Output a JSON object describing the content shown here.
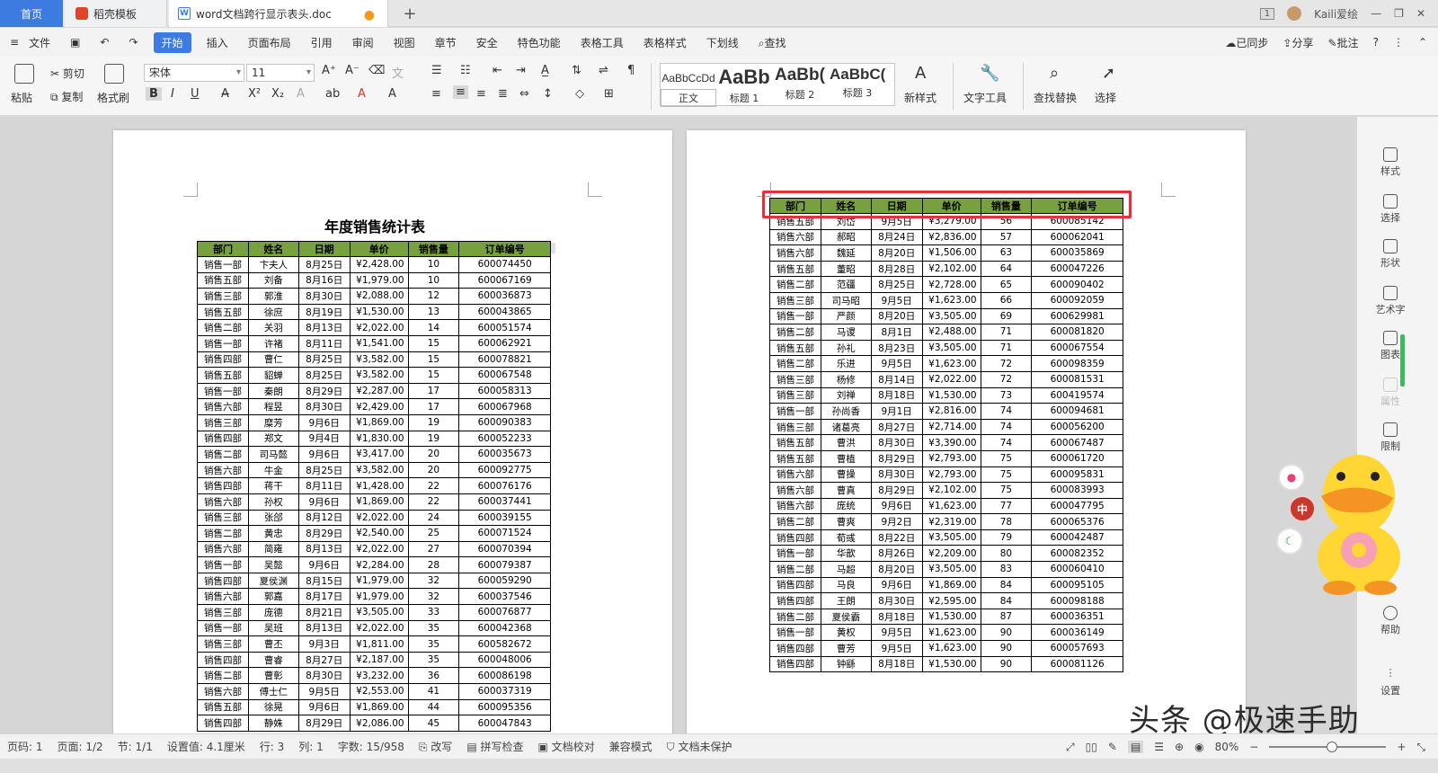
{
  "tabs": {
    "home": "首页",
    "template": "稻壳模板",
    "doc": "word文档跨行显示表头.doc",
    "doc_icon": "W"
  },
  "window": {
    "count": "1",
    "user": "Kaili爱绘"
  },
  "menu": {
    "file": "文件",
    "items": [
      "开始",
      "插入",
      "页面布局",
      "引用",
      "审阅",
      "视图",
      "章节",
      "安全",
      "特色功能",
      "表格工具",
      "表格样式",
      "下划线"
    ],
    "search": "查找",
    "sync": "已同步",
    "share": "分享",
    "comment": "批注"
  },
  "ribbon": {
    "paste": "粘贴",
    "cut": "剪切",
    "copy": "复制",
    "format_painter": "格式刷",
    "font_name": "宋体",
    "font_size": "11",
    "styles": [
      {
        "preview": "AaBbCcDd",
        "label": "正文"
      },
      {
        "preview": "AaBb",
        "label": "标题 1"
      },
      {
        "preview": "AaBb(",
        "label": "标题 2"
      },
      {
        "preview": "AaBbC(",
        "label": "标题 3"
      }
    ],
    "new_style": "新样式",
    "text_tools": "文字工具",
    "find_replace": "查找替换",
    "select": "选择"
  },
  "document": {
    "title": "年度销售统计表",
    "headers": [
      "部门",
      "姓名",
      "日期",
      "单价",
      "销售量",
      "订单编号"
    ],
    "page1_rows": [
      [
        "销售一部",
        "卞夫人",
        "8月25日",
        "¥2,428.00",
        "10",
        "600074450"
      ],
      [
        "销售五部",
        "刘备",
        "8月16日",
        "¥1,979.00",
        "10",
        "600067169"
      ],
      [
        "销售三部",
        "郭淮",
        "8月30日",
        "¥2,088.00",
        "12",
        "600036873"
      ],
      [
        "销售五部",
        "徐庶",
        "8月19日",
        "¥1,530.00",
        "13",
        "600043865"
      ],
      [
        "销售二部",
        "关羽",
        "8月13日",
        "¥2,022.00",
        "14",
        "600051574"
      ],
      [
        "销售一部",
        "许褚",
        "8月11日",
        "¥1,541.00",
        "15",
        "600062921"
      ],
      [
        "销售四部",
        "曹仁",
        "8月25日",
        "¥3,582.00",
        "15",
        "600078821"
      ],
      [
        "销售五部",
        "貂蝉",
        "8月25日",
        "¥3,582.00",
        "15",
        "600067548"
      ],
      [
        "销售一部",
        "秦朗",
        "8月29日",
        "¥2,287.00",
        "17",
        "600058313"
      ],
      [
        "销售六部",
        "程昱",
        "8月30日",
        "¥2,429.00",
        "17",
        "600067968"
      ],
      [
        "销售三部",
        "糜芳",
        "9月6日",
        "¥1,869.00",
        "19",
        "600090383"
      ],
      [
        "销售四部",
        "郑文",
        "9月4日",
        "¥1,830.00",
        "19",
        "600052233"
      ],
      [
        "销售二部",
        "司马懿",
        "9月6日",
        "¥3,417.00",
        "20",
        "600035673"
      ],
      [
        "销售六部",
        "牛金",
        "8月25日",
        "¥3,582.00",
        "20",
        "600092775"
      ],
      [
        "销售四部",
        "蒋干",
        "8月11日",
        "¥1,428.00",
        "22",
        "600076176"
      ],
      [
        "销售六部",
        "孙权",
        "9月6日",
        "¥1,869.00",
        "22",
        "600037441"
      ],
      [
        "销售三部",
        "张郃",
        "8月12日",
        "¥2,022.00",
        "24",
        "600039155"
      ],
      [
        "销售二部",
        "黄忠",
        "8月29日",
        "¥2,540.00",
        "25",
        "600071524"
      ],
      [
        "销售六部",
        "简雍",
        "8月13日",
        "¥2,022.00",
        "27",
        "600070394"
      ],
      [
        "销售一部",
        "吴懿",
        "9月6日",
        "¥2,284.00",
        "28",
        "600079387"
      ],
      [
        "销售四部",
        "夏侯渊",
        "8月15日",
        "¥1,979.00",
        "32",
        "600059290"
      ],
      [
        "销售六部",
        "郭嘉",
        "8月17日",
        "¥1,979.00",
        "32",
        "600037546"
      ],
      [
        "销售三部",
        "庞德",
        "8月21日",
        "¥3,505.00",
        "33",
        "600076877"
      ],
      [
        "销售一部",
        "吴班",
        "8月13日",
        "¥2,022.00",
        "35",
        "600042368"
      ],
      [
        "销售三部",
        "曹丕",
        "9月3日",
        "¥1,811.00",
        "35",
        "600582672"
      ],
      [
        "销售四部",
        "曹睿",
        "8月27日",
        "¥2,187.00",
        "35",
        "600048006"
      ],
      [
        "销售二部",
        "曹彰",
        "8月30日",
        "¥3,232.00",
        "36",
        "600086198"
      ],
      [
        "销售六部",
        "傅士仁",
        "9月5日",
        "¥2,553.00",
        "41",
        "600037319"
      ],
      [
        "销售五部",
        "徐晃",
        "9月6日",
        "¥1,869.00",
        "44",
        "600095356"
      ],
      [
        "销售四部",
        "静姝",
        "8月29日",
        "¥2,086.00",
        "45",
        "600047843"
      ]
    ],
    "page2_rows": [
      [
        "销售五部",
        "刘岱",
        "9月5日",
        "¥3,279.00",
        "56",
        "600085142"
      ],
      [
        "销售六部",
        "郝昭",
        "8月24日",
        "¥2,836.00",
        "57",
        "600062041"
      ],
      [
        "销售六部",
        "魏延",
        "8月20日",
        "¥1,506.00",
        "63",
        "600035869"
      ],
      [
        "销售五部",
        "董昭",
        "8月28日",
        "¥2,102.00",
        "64",
        "600047226"
      ],
      [
        "销售二部",
        "范疆",
        "8月25日",
        "¥2,728.00",
        "65",
        "600090402"
      ],
      [
        "销售三部",
        "司马昭",
        "9月5日",
        "¥1,623.00",
        "66",
        "600092059"
      ],
      [
        "销售一部",
        "严颜",
        "8月20日",
        "¥3,505.00",
        "69",
        "600629981"
      ],
      [
        "销售二部",
        "马谡",
        "8月1日",
        "¥2,488.00",
        "71",
        "600081820"
      ],
      [
        "销售五部",
        "孙礼",
        "8月23日",
        "¥3,505.00",
        "71",
        "600067554"
      ],
      [
        "销售二部",
        "乐进",
        "9月5日",
        "¥1,623.00",
        "72",
        "600098359"
      ],
      [
        "销售三部",
        "杨修",
        "8月14日",
        "¥2,022.00",
        "72",
        "600081531"
      ],
      [
        "销售三部",
        "刘禅",
        "8月18日",
        "¥1,530.00",
        "73",
        "600419574"
      ],
      [
        "销售一部",
        "孙尚香",
        "9月1日",
        "¥2,816.00",
        "74",
        "600094681"
      ],
      [
        "销售三部",
        "诸葛亮",
        "8月27日",
        "¥2,714.00",
        "74",
        "600056200"
      ],
      [
        "销售五部",
        "曹洪",
        "8月30日",
        "¥3,390.00",
        "74",
        "600067487"
      ],
      [
        "销售五部",
        "曹植",
        "8月29日",
        "¥2,793.00",
        "75",
        "600061720"
      ],
      [
        "销售六部",
        "曹操",
        "8月30日",
        "¥2,793.00",
        "75",
        "600095831"
      ],
      [
        "销售六部",
        "曹真",
        "8月29日",
        "¥2,102.00",
        "75",
        "600083993"
      ],
      [
        "销售六部",
        "庞统",
        "9月6日",
        "¥1,623.00",
        "77",
        "600047795"
      ],
      [
        "销售二部",
        "曹爽",
        "9月2日",
        "¥2,319.00",
        "78",
        "600065376"
      ],
      [
        "销售四部",
        "荀彧",
        "8月22日",
        "¥3,505.00",
        "79",
        "600042487"
      ],
      [
        "销售一部",
        "华歆",
        "8月26日",
        "¥2,209.00",
        "80",
        "600082352"
      ],
      [
        "销售二部",
        "马超",
        "8月20日",
        "¥3,505.00",
        "83",
        "600060410"
      ],
      [
        "销售四部",
        "马良",
        "9月6日",
        "¥1,869.00",
        "84",
        "600095105"
      ],
      [
        "销售四部",
        "王朗",
        "8月30日",
        "¥2,595.00",
        "84",
        "600098188"
      ],
      [
        "销售二部",
        "夏侯霸",
        "8月18日",
        "¥1,530.00",
        "87",
        "600036351"
      ],
      [
        "销售一部",
        "黄权",
        "9月5日",
        "¥1,623.00",
        "90",
        "600036149"
      ],
      [
        "销售四部",
        "曹芳",
        "9月5日",
        "¥1,623.00",
        "90",
        "600057693"
      ],
      [
        "销售四部",
        "钟繇",
        "8月18日",
        "¥1,530.00",
        "90",
        "600081126"
      ]
    ]
  },
  "sidebar": {
    "items": [
      "样式",
      "选择",
      "形状",
      "艺术字",
      "图表",
      "属性",
      "限制",
      "帮助",
      "设置"
    ]
  },
  "floating": {
    "btn2": "中"
  },
  "watermark": "头条 @极速手助",
  "status": {
    "page_num": "页码: 1",
    "page": "页面: 1/2",
    "section": "节: 1/1",
    "setting": "设置值: 4.1厘米",
    "row": "行: 3",
    "col": "列: 1",
    "words": "字数: 15/958",
    "revise": "改写",
    "spell": "拼写检查",
    "proof": "文档校对",
    "compat": "兼容模式",
    "protect": "文档未保护",
    "zoom": "80%"
  },
  "colors": {
    "accent": "#3d7be0",
    "header_green": "#77a043",
    "highlight_red": "#e2323c",
    "green_bar": "#3db95e"
  }
}
